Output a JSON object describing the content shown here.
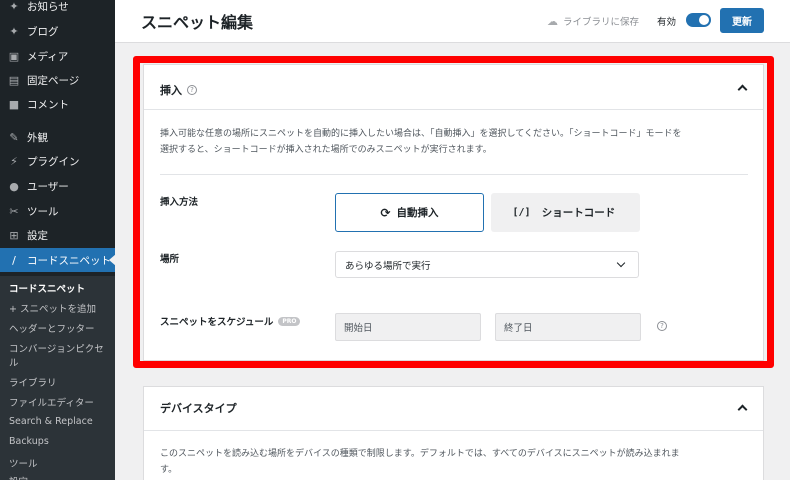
{
  "sidebar": {
    "items": [
      {
        "label": "お知らせ",
        "icon": "pin-icon"
      },
      {
        "label": "ブログ",
        "icon": "pin-icon"
      },
      {
        "label": "メディア",
        "icon": "media-icon"
      },
      {
        "label": "固定ページ",
        "icon": "page-icon"
      },
      {
        "label": "コメント",
        "icon": "comment-icon"
      },
      {
        "label": "外観",
        "icon": "brush-icon"
      },
      {
        "label": "プラグイン",
        "icon": "plugin-icon"
      },
      {
        "label": "ユーザー",
        "icon": "user-icon"
      },
      {
        "label": "ツール",
        "icon": "wrench-icon"
      },
      {
        "label": "設定",
        "icon": "settings-icon"
      },
      {
        "label": "コードスニペット",
        "icon": "code-icon"
      }
    ],
    "submenu": [
      "コードスニペット",
      "+ スニペットを追加",
      "ヘッダーとフッター",
      "コンバージョンピクセ",
      "ル",
      "ライブラリ",
      "ファイルエディター",
      "Search & Replace",
      "Backups",
      "ツール",
      "設定"
    ]
  },
  "header": {
    "title": "スニペット編集",
    "save_library": "ライブラリに保存",
    "active_label": "有効",
    "active": true,
    "update_label": "更新"
  },
  "insert_panel": {
    "title": "挿入",
    "description_line1": "挿入可能な任意の場所にスニペットを自動的に挿入したい場合は、「自動挿入」を選択してください。「ショートコード」モードを",
    "description_line2": "選択すると、ショートコードが挿入された場所でのみスニペットが実行されます。",
    "method_label": "挿入方法",
    "method_auto": "自動挿入",
    "method_shortcode_icon": "[/]",
    "method_shortcode": "ショートコード",
    "location_label": "場所",
    "location_value": "あらゆる場所で実行",
    "schedule_label": "スニペットをスケジュール",
    "pro_badge": "PRO",
    "start_placeholder": "開始日",
    "end_placeholder": "終了日"
  },
  "device_panel": {
    "title": "デバイスタイプ",
    "description_line1": "このスニペットを読み込む場所をデバイスの種類で制限します。デフォルトでは、すべてのデバイスにスニペットが読み込まれま",
    "description_line2": "す。"
  },
  "colors": {
    "accent": "#2271b1",
    "sidebar_bg": "#1d2327",
    "highlight": "#ff0000"
  }
}
